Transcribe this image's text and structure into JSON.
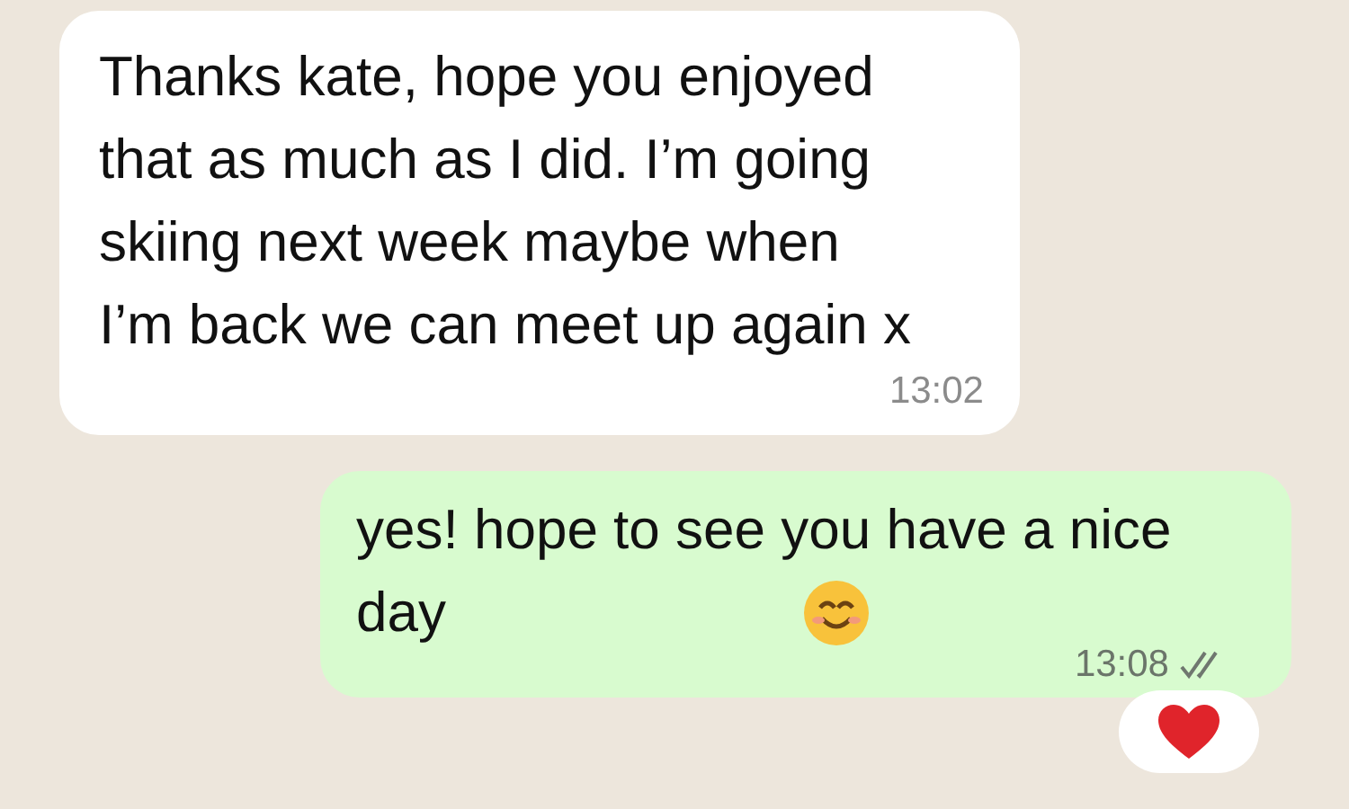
{
  "messages": [
    {
      "kind": "incoming",
      "text": "Thanks kate, hope you enjoyed that as much as I did. I’m going skiing next week maybe when I’m back we can meet up again x",
      "time": "13:02"
    },
    {
      "kind": "outgoing",
      "text": "yes! hope to see you have a nice day",
      "trailing_emoji": true,
      "time": "13:08",
      "read": false,
      "reaction": {
        "kind": "heart"
      }
    }
  ]
}
